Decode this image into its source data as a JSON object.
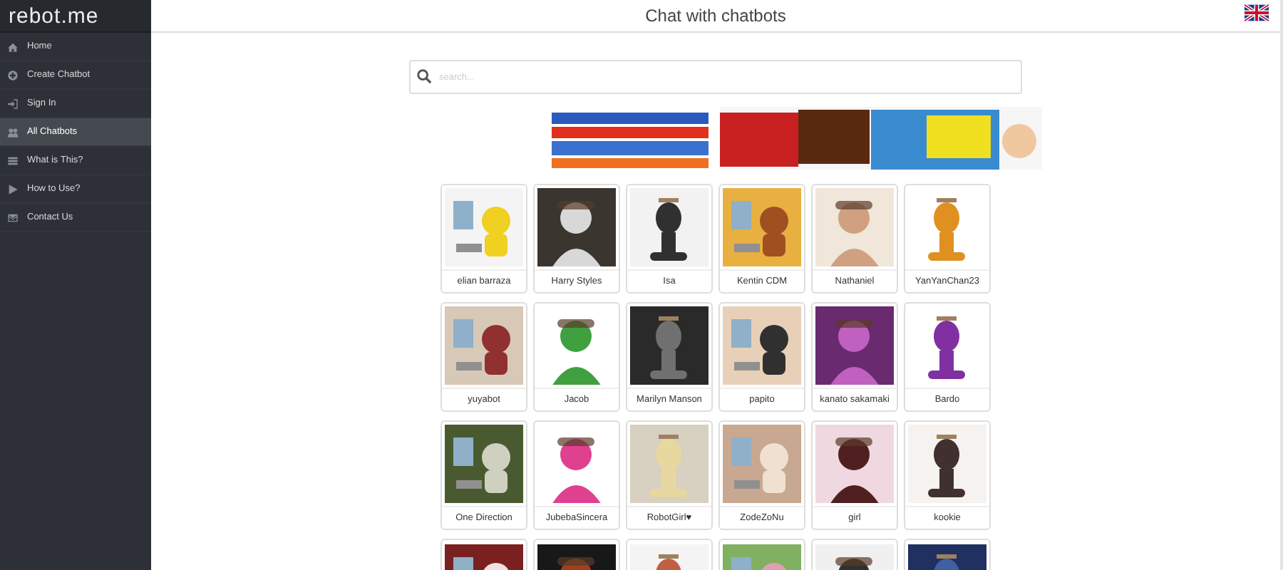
{
  "sidebar": {
    "logo": "rebot.me",
    "items": [
      {
        "label": "Home",
        "selected": false
      },
      {
        "label": "Create Chatbot",
        "selected": false
      },
      {
        "label": "Sign In",
        "selected": false
      },
      {
        "label": "All Chatbots",
        "selected": true
      },
      {
        "label": "What is This?",
        "selected": false
      },
      {
        "label": "How to Use?",
        "selected": false
      },
      {
        "label": "Contact Us",
        "selected": false
      }
    ]
  },
  "header": {
    "title": "Chat with chatbots"
  },
  "search": {
    "placeholder": "search..."
  },
  "banner": {
    "kind": "picture"
  },
  "chatbots": [
    {
      "kind": "picture",
      "name": "elian barraza"
    },
    {
      "kind": "picture",
      "name": "Harry Styles"
    },
    {
      "kind": "picture",
      "name": "Isa"
    },
    {
      "kind": "picture",
      "name": "Kentin CDM"
    },
    {
      "kind": "picture",
      "name": "Nathaniel"
    },
    {
      "kind": "picture",
      "name": "YanYanChan23"
    },
    {
      "kind": "picture",
      "name": "yuyabot"
    },
    {
      "kind": "picture",
      "name": "Jacob"
    },
    {
      "kind": "picture",
      "name": "Marilyn Manson"
    },
    {
      "kind": "picture",
      "name": "papito"
    },
    {
      "kind": "picture",
      "name": "kanato sakamaki"
    },
    {
      "kind": "picture",
      "name": "Bardo"
    },
    {
      "kind": "picture",
      "name": "One Direction"
    },
    {
      "kind": "picture",
      "name": "JubebaSincera"
    },
    {
      "kind": "picture",
      "name": "RobotGirl♥"
    },
    {
      "kind": "picture",
      "name": "ZodeZoNu"
    },
    {
      "kind": "picture",
      "name": "girl"
    },
    {
      "kind": "picture",
      "name": "kookie"
    },
    {
      "kind": "picture"
    },
    {
      "kind": "picture"
    },
    {
      "kind": "picture"
    },
    {
      "kind": "picture"
    },
    {
      "kind": "picture"
    },
    {
      "kind": "picture"
    }
  ]
}
